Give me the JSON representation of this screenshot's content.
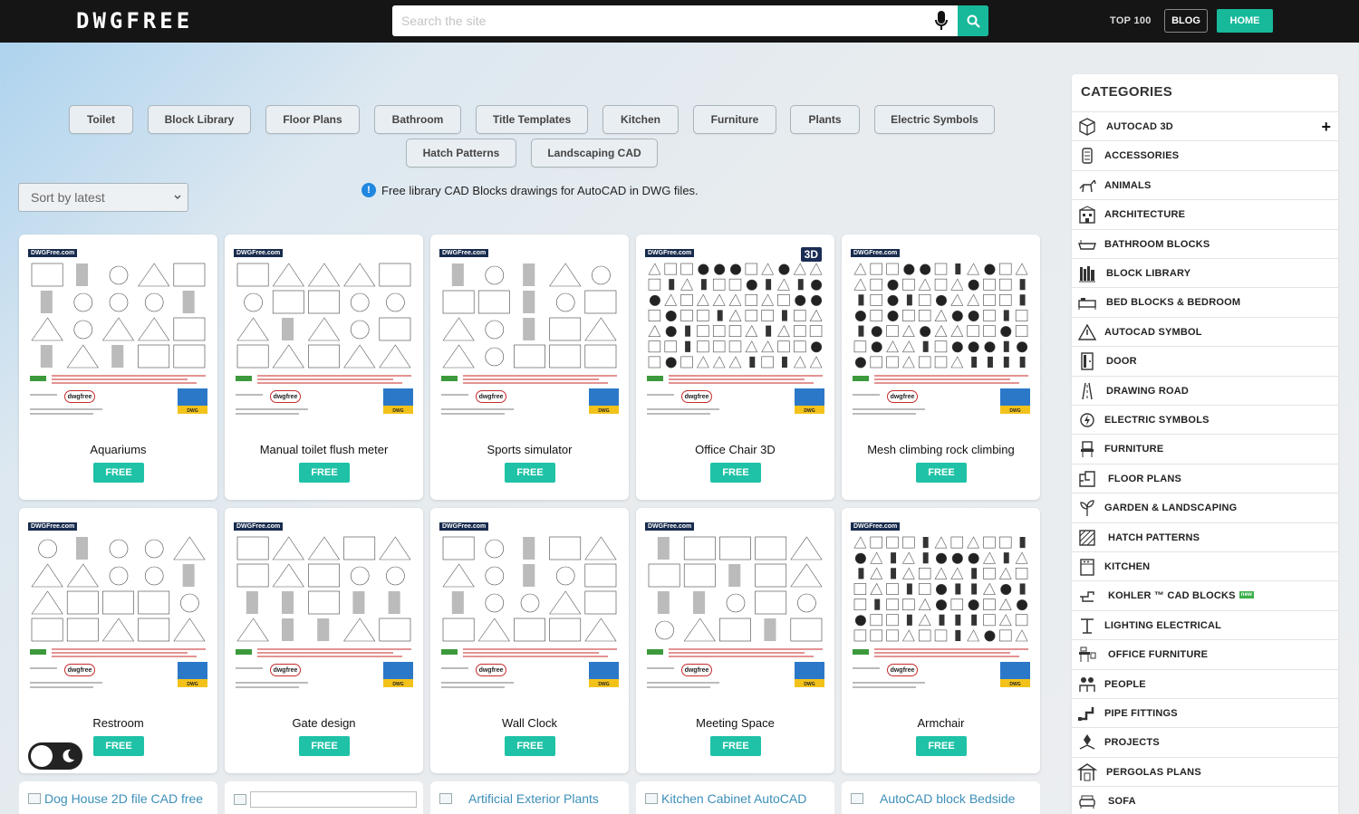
{
  "header": {
    "logo": "DWGFREE",
    "search_placeholder": "Search the site",
    "nav": {
      "top100": "TOP 100",
      "blog": "BLOG",
      "home": "HOME"
    }
  },
  "tags": [
    "Toilet",
    "Block Library",
    "Floor Plans",
    "Bathroom",
    "Title Templates",
    "Kitchen",
    "Furniture",
    "Plants",
    "Electric Symbols",
    "Hatch Patterns",
    "Landscaping CAD"
  ],
  "sort": {
    "value": "Sort by latest"
  },
  "info": {
    "text": "Free library CAD Blocks drawings for AutoCAD in DWG files."
  },
  "thumbnail": {
    "brand": "DWGFree.com",
    "pill": "dwgfree",
    "dwg": "DWG",
    "badge3d": "3D"
  },
  "cards": [
    {
      "title": "Aquariums",
      "badge": "FREE"
    },
    {
      "title": "Manual toilet flush meter",
      "badge": "FREE"
    },
    {
      "title": "Sports simulator",
      "badge": "FREE"
    },
    {
      "title": "Office Chair 3D",
      "badge": "FREE"
    },
    {
      "title": "Mesh climbing rock climbing",
      "badge": "FREE"
    },
    {
      "title": "Restroom",
      "badge": "FREE"
    },
    {
      "title": "Gate design",
      "badge": "FREE"
    },
    {
      "title": "Wall Clock",
      "badge": "FREE"
    },
    {
      "title": "Meeting Space",
      "badge": "FREE"
    },
    {
      "title": "Armchair",
      "badge": "FREE"
    }
  ],
  "partial_cards": [
    "Dog House 2D file CAD free",
    "",
    "Artificial Exterior Plants",
    "Kitchen Cabinet AutoCAD",
    "AutoCAD block Bedside"
  ],
  "sidebar": {
    "title": "CATEGORIES",
    "new_badge": "new",
    "items": [
      {
        "label": "AUTOCAD 3D",
        "icon": "cube-3d-icon"
      },
      {
        "label": "ACCESSORIES",
        "icon": "accessories-icon"
      },
      {
        "label": "ANIMALS",
        "icon": "animal-icon"
      },
      {
        "label": "ARCHITECTURE",
        "icon": "building-icon"
      },
      {
        "label": "BATHROOM BLOCKS",
        "icon": "bathtub-icon"
      },
      {
        "label": "BLOCK LIBRARY",
        "icon": "library-icon"
      },
      {
        "label": "BED BLOCKS & BEDROOM",
        "icon": "bed-icon"
      },
      {
        "label": "AUTOCAD SYMBOL",
        "icon": "warning-symbol-icon"
      },
      {
        "label": "DOOR",
        "icon": "door-icon"
      },
      {
        "label": "DRAWING ROAD",
        "icon": "road-icon"
      },
      {
        "label": "ELECTRIC SYMBOLS",
        "icon": "electric-icon"
      },
      {
        "label": "FURNITURE",
        "icon": "chair-icon"
      },
      {
        "label": "FLOOR PLANS",
        "icon": "floorplan-icon"
      },
      {
        "label": "GARDEN & LANDSCAPING",
        "icon": "plant-icon"
      },
      {
        "label": "HATCH PATTERNS",
        "icon": "hatch-icon"
      },
      {
        "label": "KITCHEN",
        "icon": "kitchen-icon"
      },
      {
        "label": "KOHLER ™ CAD BLOCKS",
        "icon": "faucet-icon"
      },
      {
        "label": "LIGHTING ELECTRICAL",
        "icon": "lamp-icon"
      },
      {
        "label": "OFFICE FURNITURE",
        "icon": "desk-icon"
      },
      {
        "label": "PEOPLE",
        "icon": "people-icon"
      },
      {
        "label": "PIPE FITTINGS",
        "icon": "pipe-icon"
      },
      {
        "label": "PROJECTS",
        "icon": "projects-icon"
      },
      {
        "label": "PERGOLAS PLANS",
        "icon": "pergola-icon"
      },
      {
        "label": "SOFA",
        "icon": "sofa-icon"
      }
    ]
  },
  "colors": {
    "accent": "#17b99a",
    "free": "#1fc2a6",
    "header": "#151515",
    "link": "#3c8fb8"
  }
}
